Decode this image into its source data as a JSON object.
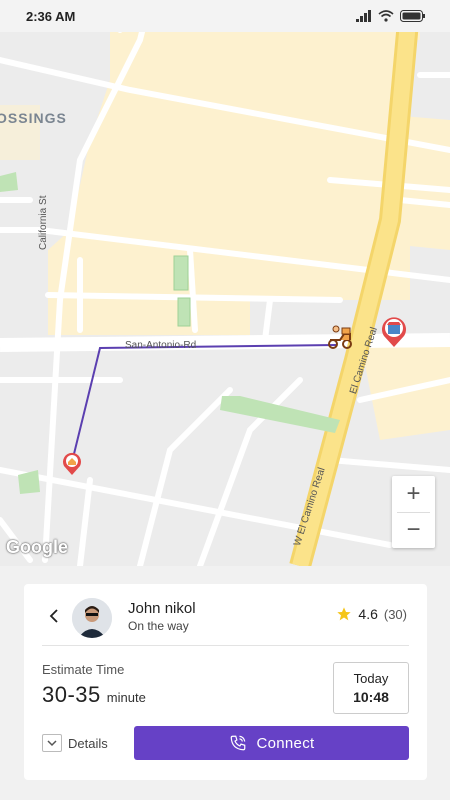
{
  "status_bar": {
    "time": "2:36 AM",
    "icons": [
      "signal-icon",
      "wifi-icon",
      "battery-icon"
    ]
  },
  "map": {
    "labels": {
      "crossings": "OSSINGS",
      "california": "California St",
      "san_antonio": "San-Antonio-Rd",
      "el_camino": "El Camino Real",
      "w_el_camino": "W El Camino Real"
    },
    "zoom_in": "+",
    "zoom_out": "−",
    "attribution": "Google",
    "markers": [
      "courier-icon",
      "store-pin-icon",
      "home-pin-icon"
    ],
    "route_color": "#5b3fb0"
  },
  "driver": {
    "name": "John nikol",
    "status": "On the way",
    "rating": "4.6",
    "rating_count": "(30)"
  },
  "estimate": {
    "label": "Estimate Time",
    "value": "30-35",
    "unit": "minute",
    "day": "Today",
    "time": "10:48"
  },
  "actions": {
    "details": "Details",
    "connect": "Connect"
  },
  "colors": {
    "accent": "#6641c6",
    "star": "#f5c518",
    "road_major": "#fbe27a",
    "area": "#fdf1cf",
    "park": "#bfe3b5"
  }
}
